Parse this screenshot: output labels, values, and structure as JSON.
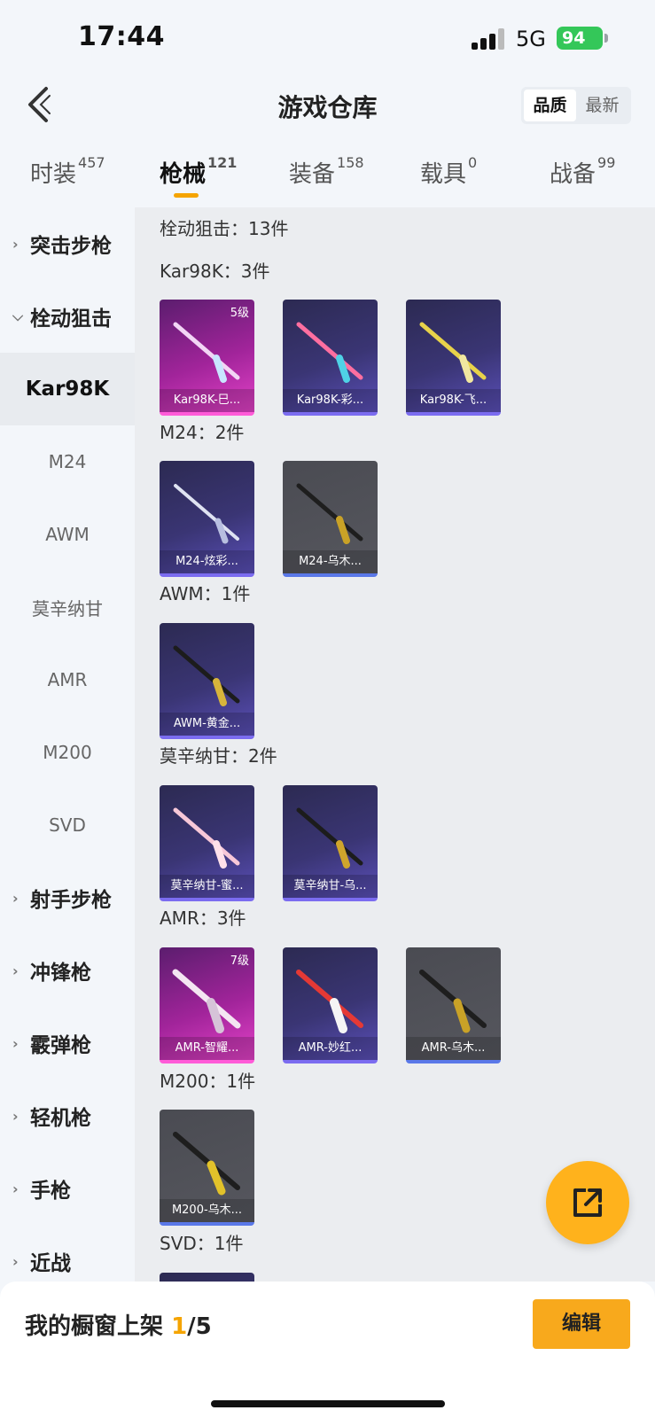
{
  "status": {
    "time": "17:44",
    "network": "5G",
    "battery": "94"
  },
  "header": {
    "title": "游戏仓库",
    "sort_quality": "品质",
    "sort_newest": "最新"
  },
  "tabs": [
    {
      "label": "时装",
      "count": "457"
    },
    {
      "label": "枪械",
      "count": "121"
    },
    {
      "label": "装备",
      "count": "158"
    },
    {
      "label": "载具",
      "count": "0"
    },
    {
      "label": "战备",
      "count": "99"
    }
  ],
  "sidebar": {
    "cat_assault": "突击步枪",
    "cat_bolt": "栓动狙击",
    "sub_kar98k": "Kar98K",
    "sub_m24": "M24",
    "sub_awm": "AWM",
    "sub_mosin": "莫辛纳甘",
    "sub_amr": "AMR",
    "sub_m200": "M200",
    "sub_svd": "SVD",
    "cat_marksman": "射手步枪",
    "cat_smg": "冲锋枪",
    "cat_shotgun": "霰弹枪",
    "cat_lmg": "轻机枪",
    "cat_pistol": "手枪",
    "cat_melee": "近战"
  },
  "content": {
    "total": "栓动狙击：13件",
    "kar98k": {
      "title": "Kar98K：3件",
      "items": [
        {
          "name": "Kar98K-巳...",
          "level": "5级"
        },
        {
          "name": "Kar98K-彩..."
        },
        {
          "name": "Kar98K-飞..."
        }
      ]
    },
    "m24": {
      "title": "M24：2件",
      "items": [
        {
          "name": "M24-炫彩..."
        },
        {
          "name": "M24-乌木..."
        }
      ]
    },
    "awm": {
      "title": "AWM：1件",
      "items": [
        {
          "name": "AWM-黄金..."
        }
      ]
    },
    "mosin": {
      "title": "莫辛纳甘：2件",
      "items": [
        {
          "name": "莫辛纳甘-蜜..."
        },
        {
          "name": "莫辛纳甘-乌..."
        }
      ]
    },
    "amr": {
      "title": "AMR：3件",
      "items": [
        {
          "name": "AMR-智耀...",
          "level": "7级"
        },
        {
          "name": "AMR-妙红..."
        },
        {
          "name": "AMR-乌木..."
        }
      ]
    },
    "m200": {
      "title": "M200：1件",
      "items": [
        {
          "name": "M200-乌木..."
        }
      ]
    },
    "svd": {
      "title": "SVD：1件"
    }
  },
  "bottom": {
    "shelf_label": "我的橱窗上架",
    "shelf_used": "1",
    "shelf_total": "/5",
    "edit": "编辑"
  },
  "colors": {
    "accent": "#f5a400",
    "legendary": "#e242c7",
    "epic": "#5a4fb8",
    "rare_border": "#5a78e8"
  }
}
